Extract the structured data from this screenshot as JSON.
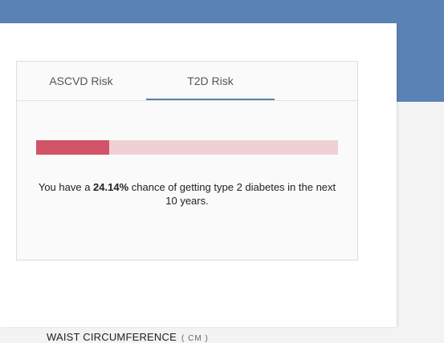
{
  "tabs": [
    {
      "label": "ASCVD Risk",
      "active": false
    },
    {
      "label": "T2D Risk",
      "active": true
    }
  ],
  "risk": {
    "percent_label": "24.14%",
    "fraction": 0.2414,
    "text_before": "You have a ",
    "text_after": " chance of getting type 2 diabetes in the next 10 years.",
    "bar_fill_color": "#d15468",
    "bar_track_color": "#f0d0d5"
  },
  "waist": {
    "label": "WAIST CIRCUMFERENCE",
    "unit": "( CM )"
  },
  "colors": {
    "brand_blue": "#5b82b4"
  }
}
